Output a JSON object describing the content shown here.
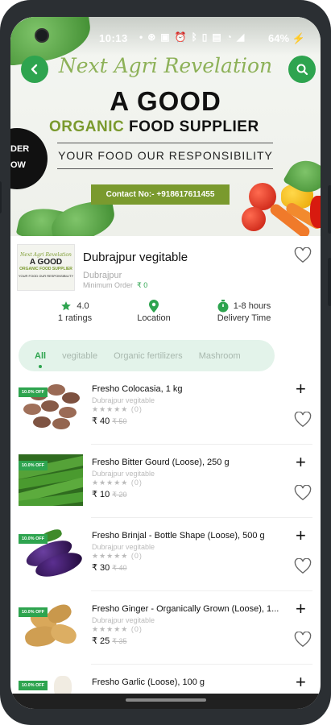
{
  "status_bar": {
    "time": "10:13",
    "battery": "64%"
  },
  "banner": {
    "brand": "Next Agri Revelation",
    "headline": "A GOOD",
    "subhead_green": "ORGANIC",
    "subhead_dark": "FOOD SUPPLIER",
    "tagline": "YOUR FOOD OUR RESPONSIBILITY",
    "contact": "Contact No:- +918617611455",
    "badge": "DER\nOW"
  },
  "shop": {
    "thumb": {
      "brand": "Next Agri Revelation",
      "headline": "A GOOD",
      "subhead": "ORGANIC FOOD SUPPLIER",
      "tagline": "YOUR FOOD OUR RESPONSIBILITY"
    },
    "name": "Dubrajpur vegitable",
    "location": "Dubrajpur",
    "min_order_label": "Minimum Order",
    "min_order_value": "₹ 0"
  },
  "stats": {
    "rating_value": "4.0",
    "rating_count": "1 ratings",
    "location_label": "Location",
    "delivery_value": "1-8 hours",
    "delivery_label": "Delivery Time"
  },
  "tabs": [
    "All",
    "vegitable",
    "Organic fertilizers",
    "Mashroom"
  ],
  "products": [
    {
      "name": "Fresho Colocasia, 1 kg",
      "shop": "Dubrajpur vegitable",
      "rating": "(0)",
      "price": "₹ 40",
      "mrp": "₹ 50",
      "offer": "10.0% OFF"
    },
    {
      "name": "Fresho Bitter Gourd (Loose), 250 g",
      "shop": "Dubrajpur vegitable",
      "rating": "(0)",
      "price": "₹ 10",
      "mrp": "₹ 20",
      "offer": "10.0% OFF"
    },
    {
      "name": "Fresho Brinjal - Bottle Shape (Loose), 500 g",
      "shop": "Dubrajpur vegitable",
      "rating": "(0)",
      "price": "₹ 30",
      "mrp": "₹ 40",
      "offer": "10.0% OFF"
    },
    {
      "name": "Fresho Ginger - Organically Grown (Loose), 1...",
      "shop": "Dubrajpur vegitable",
      "rating": "(0)",
      "price": "₹ 25",
      "mrp": "₹ 35",
      "offer": "10.0% OFF"
    },
    {
      "name": "Fresho Garlic (Loose), 100 g",
      "offer": "10.0% OFF"
    }
  ],
  "colors": {
    "accent": "#2ea44f",
    "brand_olive": "#7a9a2e"
  }
}
